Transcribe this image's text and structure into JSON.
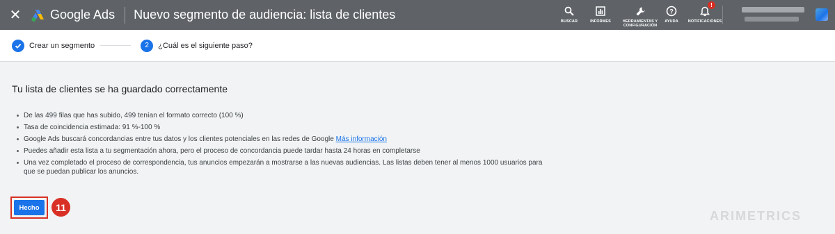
{
  "app": {
    "brand": "Google Ads",
    "page_title": "Nuevo segmento de audiencia: lista de clientes"
  },
  "topnav": {
    "items": [
      {
        "label": "BUSCAR",
        "icon": "search-icon"
      },
      {
        "label": "INFORMES",
        "icon": "reports-icon"
      },
      {
        "label": "HERRAMIENTAS Y CONFIGURACIÓN",
        "icon": "wrench-icon"
      },
      {
        "label": "AYUDA",
        "icon": "help-icon"
      },
      {
        "label": "NOTIFICACIONES",
        "icon": "bell-icon",
        "badge": "!"
      }
    ]
  },
  "stepper": {
    "step1": "Crear un segmento",
    "step2_number": "2",
    "step2": "¿Cuál es el siguiente paso?"
  },
  "main": {
    "heading": "Tu lista de clientes se ha guardado correctamente",
    "bullets": [
      "De las 499 filas que has subido, 499 tenían el formato correcto (100 %)",
      "Tasa de coincidencia estimada: 91 %-100 %",
      "Google Ads buscará concordancias entre tus datos y los clientes potenciales en las redes de Google",
      "Puedes añadir esta lista a tu segmentación ahora, pero el proceso de concordancia puede tardar hasta 24 horas en completarse",
      "Una vez completado el proceso de correspondencia, tus anuncios empezarán a mostrarse a las nuevas audiencias. Las listas deben tener al menos 1000 usuarios para que se puedan publicar los anuncios."
    ],
    "link_text": "Más información",
    "done_button": "Hecho",
    "annotation_number": "11"
  },
  "watermark": "ARIMETRICS",
  "colors": {
    "topbar": "#5f6368",
    "primary": "#1a73e8",
    "annotation_red": "#d93025"
  }
}
